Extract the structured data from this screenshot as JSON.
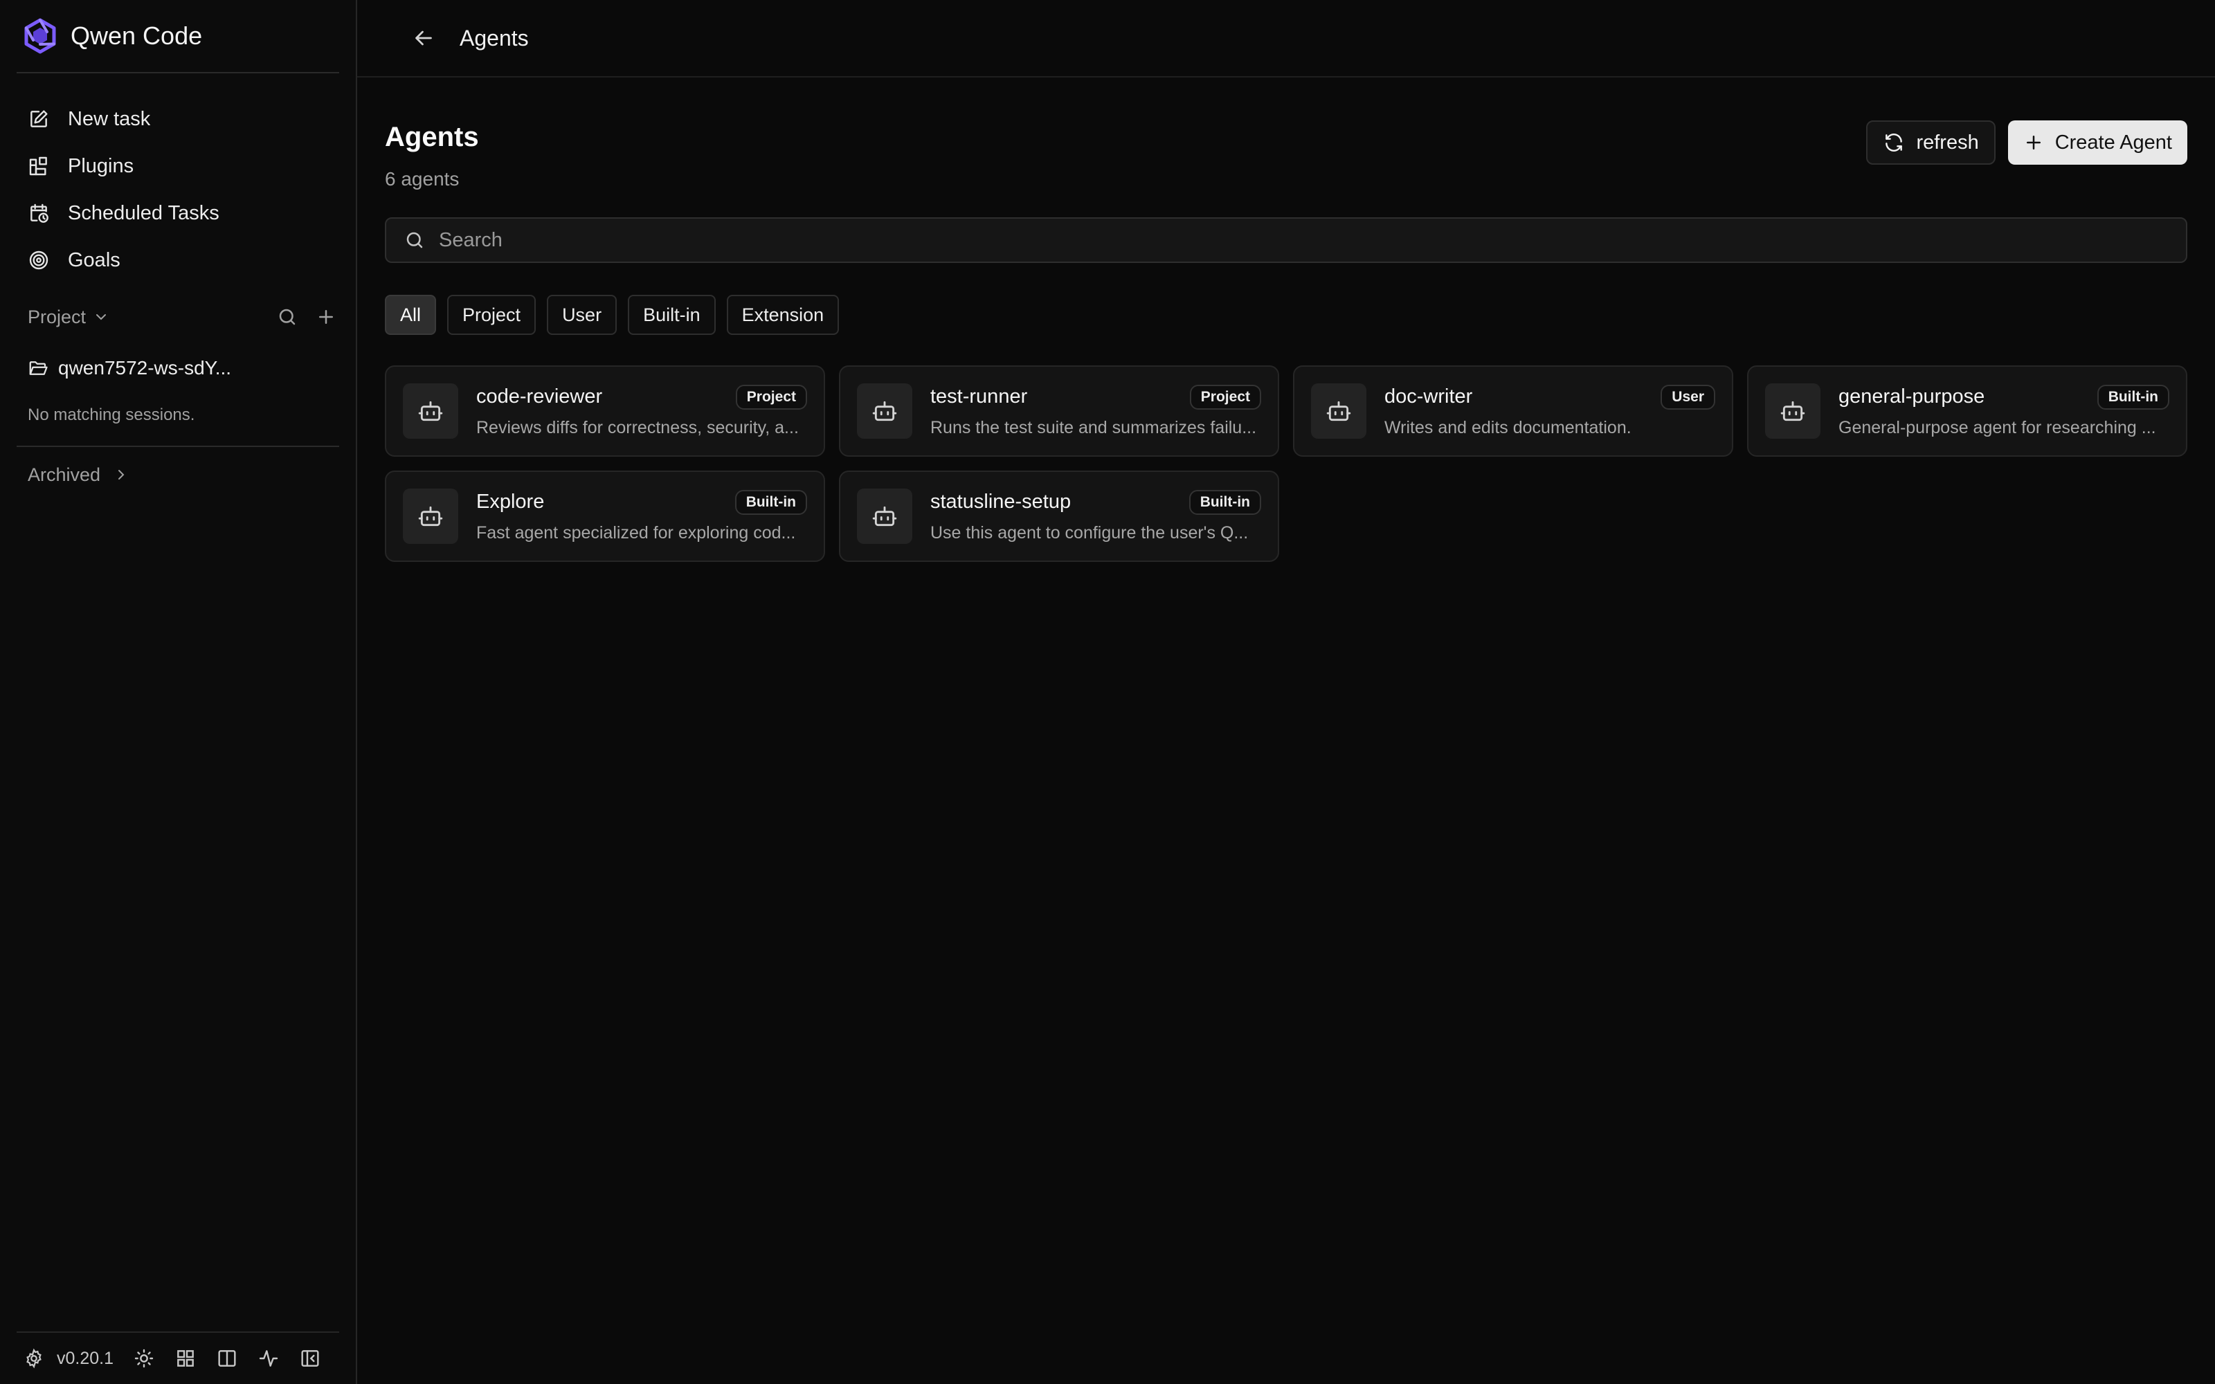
{
  "brand": {
    "name": "Qwen Code",
    "accent": "#7c5cff"
  },
  "nav": [
    {
      "label": "New task",
      "icon": "edit-icon"
    },
    {
      "label": "Plugins",
      "icon": "plugins-icon"
    },
    {
      "label": "Scheduled Tasks",
      "icon": "calendar-clock-icon"
    },
    {
      "label": "Goals",
      "icon": "target-icon"
    }
  ],
  "project": {
    "title": "Project",
    "folder": "qwen7572-ws-sdY...",
    "empty": "No matching sessions."
  },
  "archived": {
    "label": "Archived"
  },
  "footer": {
    "version": "v0.20.1"
  },
  "topbar": {
    "crumb": "Agents"
  },
  "page": {
    "title": "Agents",
    "count": "6 agents",
    "refresh_label": "refresh",
    "create_label": "Create Agent",
    "search_placeholder": "Search"
  },
  "filters": [
    {
      "label": "All",
      "active": true
    },
    {
      "label": "Project",
      "active": false
    },
    {
      "label": "User",
      "active": false
    },
    {
      "label": "Built-in",
      "active": false
    },
    {
      "label": "Extension",
      "active": false
    }
  ],
  "agents": [
    {
      "name": "code-reviewer",
      "badge": "Project",
      "desc": "Reviews diffs for correctness, security, a..."
    },
    {
      "name": "test-runner",
      "badge": "Project",
      "desc": "Runs the test suite and summarizes failu..."
    },
    {
      "name": "doc-writer",
      "badge": "User",
      "desc": "Writes and edits documentation."
    },
    {
      "name": "general-purpose",
      "badge": "Built-in",
      "desc": "General-purpose agent for researching ..."
    },
    {
      "name": "Explore",
      "badge": "Built-in",
      "desc": "Fast agent specialized for exploring cod..."
    },
    {
      "name": "statusline-setup",
      "badge": "Built-in",
      "desc": "Use this agent to configure the user's Q..."
    }
  ]
}
